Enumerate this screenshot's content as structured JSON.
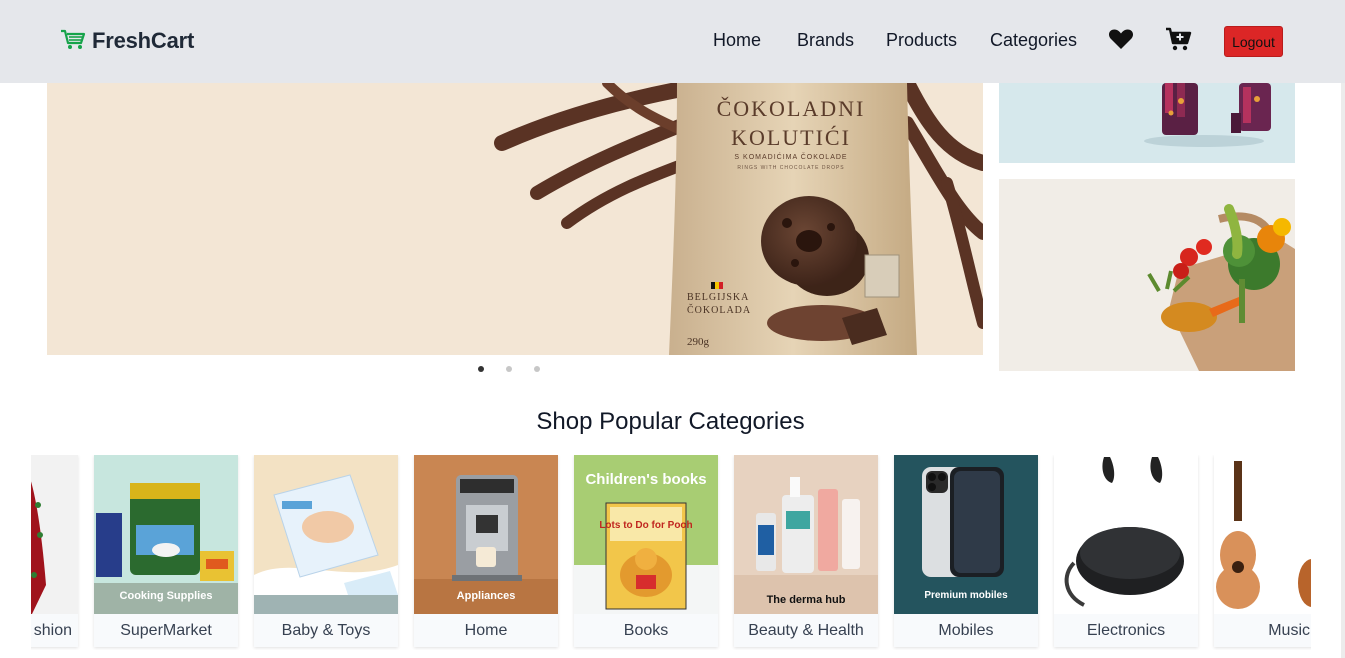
{
  "brand": {
    "name": "FreshCart",
    "icon": "cart-icon",
    "accent": "#16a34a"
  },
  "nav": {
    "links": [
      "Home",
      "Brands",
      "Products",
      "Categories"
    ],
    "wishlist_icon": "heart-icon",
    "cart_icon": "cart-plus-icon",
    "logout_label": "Logout",
    "logout_color": "#dc2626"
  },
  "hero": {
    "product_title_line1": "ČOKOLADNI",
    "product_title_line2": "KOLUTIĆI",
    "product_subtitle": "S KOMADIĆIMA ČOKOLADE",
    "product_subtitle_en": "RINGS WITH CHOCOLATE DROPS",
    "product_badge_line1": "BELGIJSKA",
    "product_badge_line2": "ČOKOLADA",
    "product_weight": "290g",
    "slide_count": 3,
    "active_slide": 1
  },
  "section_title": "Shop Popular Categories",
  "categories": [
    {
      "label": "Fashion",
      "visible_label": "shion",
      "overlay": ""
    },
    {
      "label": "SuperMarket",
      "overlay": "Cooking Supplies"
    },
    {
      "label": "Baby & Toys",
      "overlay": ""
    },
    {
      "label": "Home",
      "overlay": "Appliances"
    },
    {
      "label": "Books",
      "overlay": "Children's books",
      "book_title": "Lots to Do for Pooh"
    },
    {
      "label": "Beauty & Health",
      "overlay": "The derma hub"
    },
    {
      "label": "Mobiles",
      "overlay": "Premium mobiles"
    },
    {
      "label": "Electronics",
      "overlay": ""
    },
    {
      "label": "Music",
      "visible_label": "Music",
      "overlay": ""
    }
  ]
}
